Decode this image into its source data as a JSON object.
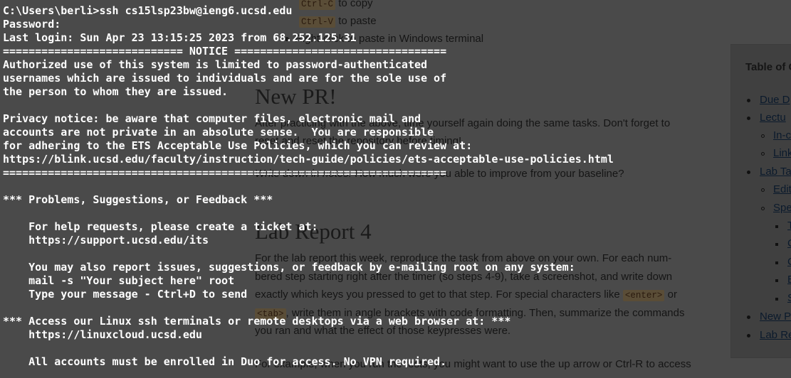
{
  "terminal": {
    "lines": [
      "C:\\Users\\berli>ssh cs15lsp23bw@ieng6.ucsd.edu",
      "Password:",
      "Last login: Sun Apr 23 13:15:25 2023 from 68.252.125.31",
      "============================ NOTICE =================================",
      "Authorized use of this system is limited to password-authenticated",
      "usernames which are issued to individuals and are for the sole use of",
      "the person to whom they are issued.",
      "",
      "Privacy notice: be aware that computer files, electronic mail and",
      "accounts are not private in an absolute sense.  You are responsible",
      "for adhering to the ETS Acceptable Use Policies, which you can review at:",
      "https://blink.ucsd.edu/faculty/instruction/tech-guide/policies/ets-acceptable-use-policies.html",
      "=====================================================================",
      "",
      "*** Problems, Suggestions, or Feedback ***",
      "",
      "    For help requests, please create a ticket at:",
      "    https://support.ucsd.edu/its",
      "",
      "    You may also report issues, suggestions, or feedback by e-mailing root on any system:",
      "    mail -s \"Your subject here\" root",
      "    Type your message - Ctrl+D to send",
      "",
      "*** Access our Linux ssh terminals or remote desktops via a web browser at: ***",
      "    https://linuxcloud.ucsd.edu",
      "",
      "    All accounts must be enrolled in Duo for access. No VPN required."
    ]
  },
  "doc": {
    "copy_key": "Ctrl-C",
    "copy_text": "to copy",
    "paste_key": "Ctrl-V",
    "paste_text": "to paste",
    "right_click_text": "Right-click to paste in Windows terminal",
    "new_pr_heading": "New PR!",
    "new_pr_p1": "After practicing with the above, time yourself again doing the same tasks. Don't forget to",
    "new_pr_p2": "reset and reset the repository before timing!",
    "new_pr_p3_em": "Write down in notes:",
    "new_pr_p3": "How much were you able to improve from your baseline?",
    "lab_report_heading": "Lab Report 4",
    "lr_l1": "For the lab report this week, reproduce the task from above on your own. For each num-",
    "lr_l2": "bered step starting right after the timer (so steps 4-9), take a screenshot, and write down",
    "lr_l3a": "exactly which keys you pressed to get to that step. For special characters like",
    "lr_enter": "<enter>",
    "lr_l3b": "or",
    "lr_tab": "<tab>",
    "lr_l4": ", write them in angle brackets with code formatting. Then, summarize the commands",
    "lr_l5": "you ran and what the effect of those keypresses were.",
    "lr_l6": "For example, when you run the tests, you might want to use the up arrow or Ctrl-R to access"
  },
  "toc": {
    "title": "Table of C",
    "items": [
      {
        "label": "Due D"
      },
      {
        "label": "Lectu"
      },
      {
        "label": "In-c"
      },
      {
        "label": "Link"
      },
      {
        "label": "Lab Ta"
      },
      {
        "label": "Edit"
      },
      {
        "label": "Spe"
      },
      {
        "label": "T"
      },
      {
        "label": "C"
      },
      {
        "label": "C"
      },
      {
        "label": "E"
      },
      {
        "label": "S"
      },
      {
        "label": "New P"
      },
      {
        "label": "Lab Re"
      }
    ]
  }
}
